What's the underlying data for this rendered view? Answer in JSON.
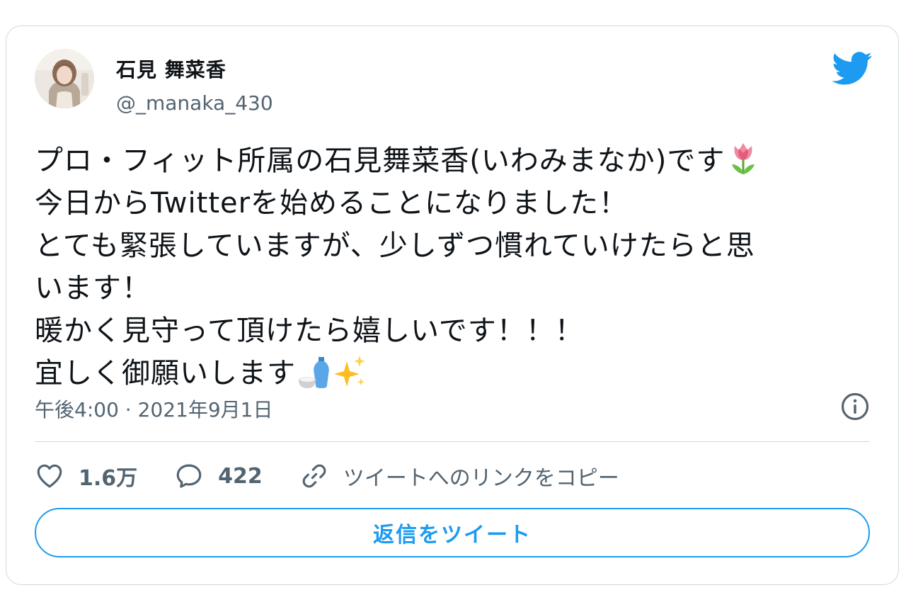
{
  "author": {
    "name": "石見 舞菜香",
    "handle": "@_manaka_430"
  },
  "tweet": {
    "lines": [
      "プロ・フィット所属の石見舞菜香(いわみまなか)です",
      "今日からTwitterを始めることになりました！",
      "とても緊張していますが、少しずつ慣れていけたらと思",
      "います！",
      "暖かく見守って頂けたら嬉しいです！！！",
      "宜しく御願いします"
    ],
    "emojis": [
      "tulip-emoji",
      "sake-emoji",
      "sparkles-emoji"
    ],
    "timestamp": "午後4:00 · 2021年9月1日"
  },
  "actions": {
    "likes": "1.6万",
    "replies": "422",
    "copy_link_label": "ツイートへのリンクをコピー"
  },
  "reply_button": {
    "label": "返信をツイート"
  },
  "colors": {
    "accent": "#1d9bf0",
    "secondary_text": "#536471",
    "border": "#cfd9de"
  },
  "icons": {
    "brand": "twitter-bird-icon",
    "info": "info-icon",
    "like": "heart-icon",
    "reply": "speech-bubble-icon",
    "link": "link-icon"
  }
}
